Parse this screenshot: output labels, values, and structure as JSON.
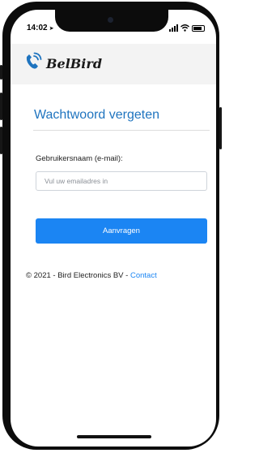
{
  "status_bar": {
    "time": "14:02",
    "location_icon": "location-arrow-icon",
    "signal_icon": "signal-icon",
    "wifi_icon": "wifi-icon",
    "battery_icon": "battery-icon"
  },
  "app": {
    "logo_text": "BelBird",
    "logo_icon": "phone-waves-icon",
    "brand_color": "#1f74bf"
  },
  "form": {
    "title": "Wachtwoord vergeten",
    "email_label": "Gebruikersnaam (e-mail):",
    "email_value": "",
    "email_placeholder": "Vul uw emailadres in",
    "submit_label": "Aanvragen",
    "button_color": "#1b85f3"
  },
  "footer": {
    "copyright": "© 2021 - Bird Electronics BV - ",
    "contact_link": "Contact"
  }
}
